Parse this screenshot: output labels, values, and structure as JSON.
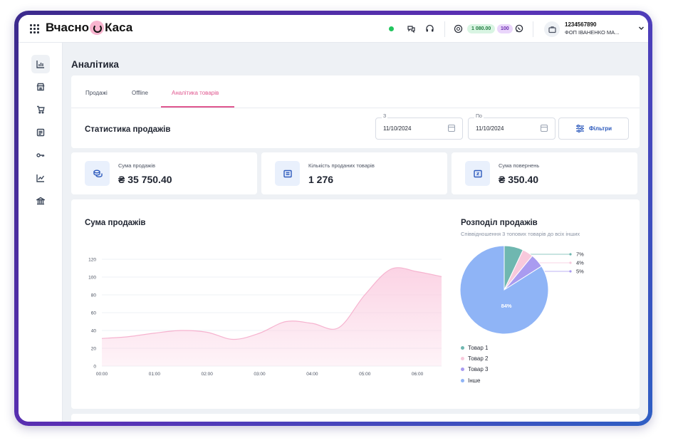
{
  "header": {
    "logo_left": "Вчасно",
    "logo_right": "Каса",
    "balance": "1 080.00",
    "count": "100",
    "account_id": "1234567890",
    "account_name": "ФОП ІВАНЕНКО МА..."
  },
  "sidebar": {
    "items": [
      {
        "icon": "analytics-icon"
      },
      {
        "icon": "store-icon"
      },
      {
        "icon": "cart-icon"
      },
      {
        "icon": "document-icon"
      },
      {
        "icon": "key-icon"
      },
      {
        "icon": "trend-icon"
      },
      {
        "icon": "bank-icon"
      }
    ]
  },
  "page": {
    "title": "Аналітика",
    "tabs": [
      {
        "label": "Продажі"
      },
      {
        "label": "Offline"
      },
      {
        "label": "Аналітика товарів"
      }
    ],
    "stats_title": "Статистика продажів",
    "date_from_label": "З",
    "date_from": "11/10/2024",
    "date_to_label": "По",
    "date_to": "11/10/2024",
    "filter_label": "Фільтри"
  },
  "kpis": [
    {
      "label": "Сума продажів",
      "value": "₴ 35 750.40"
    },
    {
      "label": "Кількість проданих товарів",
      "value": "1 276"
    },
    {
      "label": "Сума повернень",
      "value": "₴ 350.40"
    }
  ],
  "colors": {
    "accent": "#e0578f",
    "line_fill": "#fbd1e3",
    "line_stroke": "#f6b3cf",
    "pie_other": "#8fb4f6",
    "pie_1": "#6fb7b0",
    "pie_2": "#f8c9dc",
    "pie_3": "#a99bf0"
  },
  "chart_data": [
    {
      "type": "area",
      "title": "Сума продажів",
      "x": [
        "00:00",
        "00:30",
        "01:00",
        "01:30",
        "02:00",
        "02:30",
        "03:00",
        "03:30",
        "04:00",
        "04:30",
        "05:00",
        "05:30",
        "06:00",
        "06:30"
      ],
      "xticks": [
        "00:00",
        "01:00",
        "02:00",
        "03:00",
        "04:00",
        "05:00",
        "06:00"
      ],
      "series": [
        {
          "values": [
            31,
            33,
            37,
            40,
            38,
            30,
            37,
            50,
            48,
            43,
            80,
            109,
            106,
            100
          ]
        }
      ],
      "ylim": [
        0,
        120
      ],
      "yticks": [
        0,
        20,
        40,
        60,
        80,
        100,
        120
      ],
      "grid": true
    },
    {
      "type": "pie",
      "title": "Розподіл продажів",
      "subtitle": "Співвідношення 3 топових товарів до всіх інших",
      "slices": [
        {
          "name": "Товар 1",
          "value": 7,
          "label": "7%"
        },
        {
          "name": "Товар 2",
          "value": 4,
          "label": "4%"
        },
        {
          "name": "Товар 3",
          "value": 5,
          "label": "5%"
        },
        {
          "name": "Інше",
          "value": 84,
          "label": "84%"
        }
      ],
      "legend": "bottom"
    }
  ]
}
